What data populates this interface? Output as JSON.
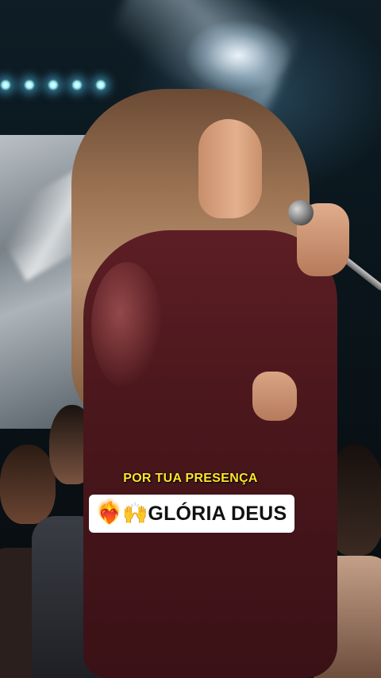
{
  "video": {
    "scene": "worship-stage",
    "caption_line_1": "POR TUA PRESENÇA",
    "caption_line_2": "GLÓRIA DEUS",
    "emoji_1": "❤️‍🔥",
    "emoji_2": "🙌",
    "colors": {
      "caption_line_1": "#ffe62a",
      "caption_box_bg": "#ffffff",
      "caption_line_2": "#111111",
      "jacket": "#5c1e24",
      "stage_light": "#9ef3ff"
    }
  }
}
